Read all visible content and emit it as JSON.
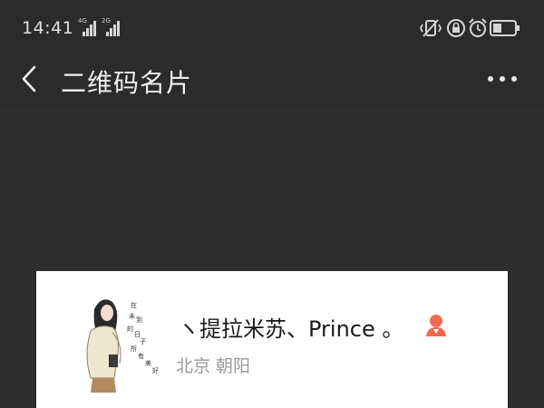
{
  "status_bar": {
    "time": "14:41",
    "network_1": "4G",
    "network_2": "2G",
    "icons": [
      "vibrate-icon",
      "lock-rotation-icon",
      "alarm-icon",
      "battery-icon"
    ]
  },
  "nav": {
    "title": "二维码名片",
    "back_icon": "chevron-left-icon",
    "more_icon": "more-dots-icon"
  },
  "card": {
    "name": "ヽ提拉米苏、Prince 。",
    "location": "北京 朝阳",
    "gender_icon": "female-person-icon",
    "gender_color": "#f06a50"
  },
  "colors": {
    "background": "#2e2e2e",
    "card": "#ffffff",
    "title": "#f0f0f0"
  }
}
